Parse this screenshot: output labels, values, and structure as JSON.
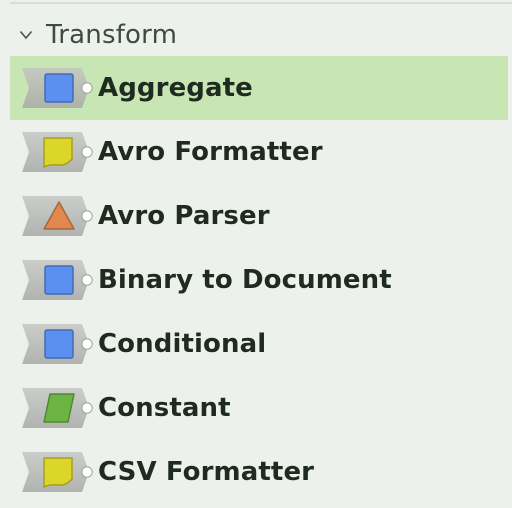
{
  "section": {
    "title": "Transform",
    "icon": "chevron-down-icon"
  },
  "items": [
    {
      "label": "Aggregate",
      "shape": "square",
      "color": "#5b8ff0",
      "selected": true
    },
    {
      "label": "Avro Formatter",
      "shape": "doc",
      "color": "#dcd62a",
      "selected": false
    },
    {
      "label": "Avro Parser",
      "shape": "triangle",
      "color": "#e0884e",
      "selected": false
    },
    {
      "label": "Binary to Document",
      "shape": "square",
      "color": "#5b8ff0",
      "selected": false
    },
    {
      "label": "Conditional",
      "shape": "square",
      "color": "#5b8ff0",
      "selected": false
    },
    {
      "label": "Constant",
      "shape": "parallelogram",
      "color": "#6cb544",
      "selected": false
    },
    {
      "label": "CSV Formatter",
      "shape": "doc",
      "color": "#dcd62a",
      "selected": false
    }
  ],
  "colors": {
    "selected_bg": "#c8e6b3",
    "background": "#edf1ec",
    "badge_bg": "#a7a9a6"
  }
}
